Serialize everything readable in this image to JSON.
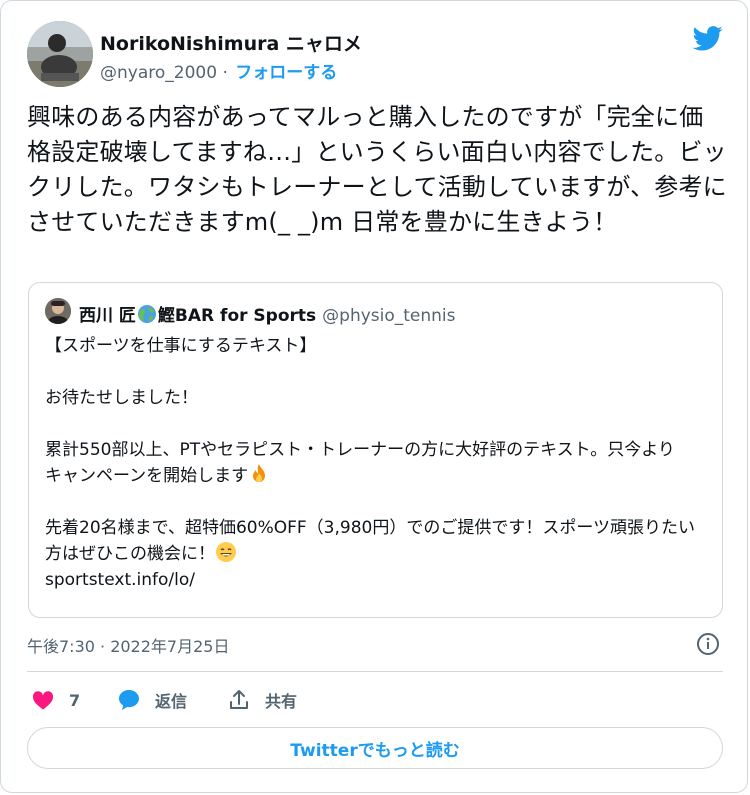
{
  "author": {
    "name": "NorikoNishimura ニャロメ",
    "handle": "@nyaro_2000",
    "separator": " · ",
    "follow_label": "フォローする"
  },
  "tweet": {
    "text": "興味のある内容があってマルっと購入したのですが「完全に価格設定破壊してますね…」というくらい面白い内容でした。ビックリした。ワタシもトレーナーとして活動していますが、参考にさせていただきますm(_ _)m 日常を豊かに生きよう！"
  },
  "quote": {
    "name_part1": "西川 匠",
    "name_part2": "鰹BAR for Sports",
    "handle": "@physio_tennis",
    "line1": "【スポーツを仕事にするテキスト】",
    "line2": "お待たせしました！",
    "line3": "累計550部以上、PTやセラピスト・トレーナーの方に大好評のテキスト。只今よりキャンペーンを開始します",
    "line4": "先着20名様まで、超特価60%OFF（3,980円）でのご提供です！スポーツ頑張りたい方はぜひこの機会に！",
    "link": "sportstext.info/lo/"
  },
  "meta": {
    "timestamp": "午後7:30 · 2022年7月25日"
  },
  "actions": {
    "like_count": "7",
    "reply_label": "返信",
    "share_label": "共有"
  },
  "footer": {
    "read_more_label": "Twitterでもっと読む"
  },
  "colors": {
    "accent": "#1d9bf0",
    "like": "#f91880",
    "muted": "#536471",
    "border": "#cfd9de"
  },
  "icons": [
    "twitter-bird-icon",
    "globe-icon",
    "fire-icon",
    "grinning-face-icon",
    "info-icon",
    "heart-icon",
    "reply-bubble-icon",
    "share-icon"
  ]
}
